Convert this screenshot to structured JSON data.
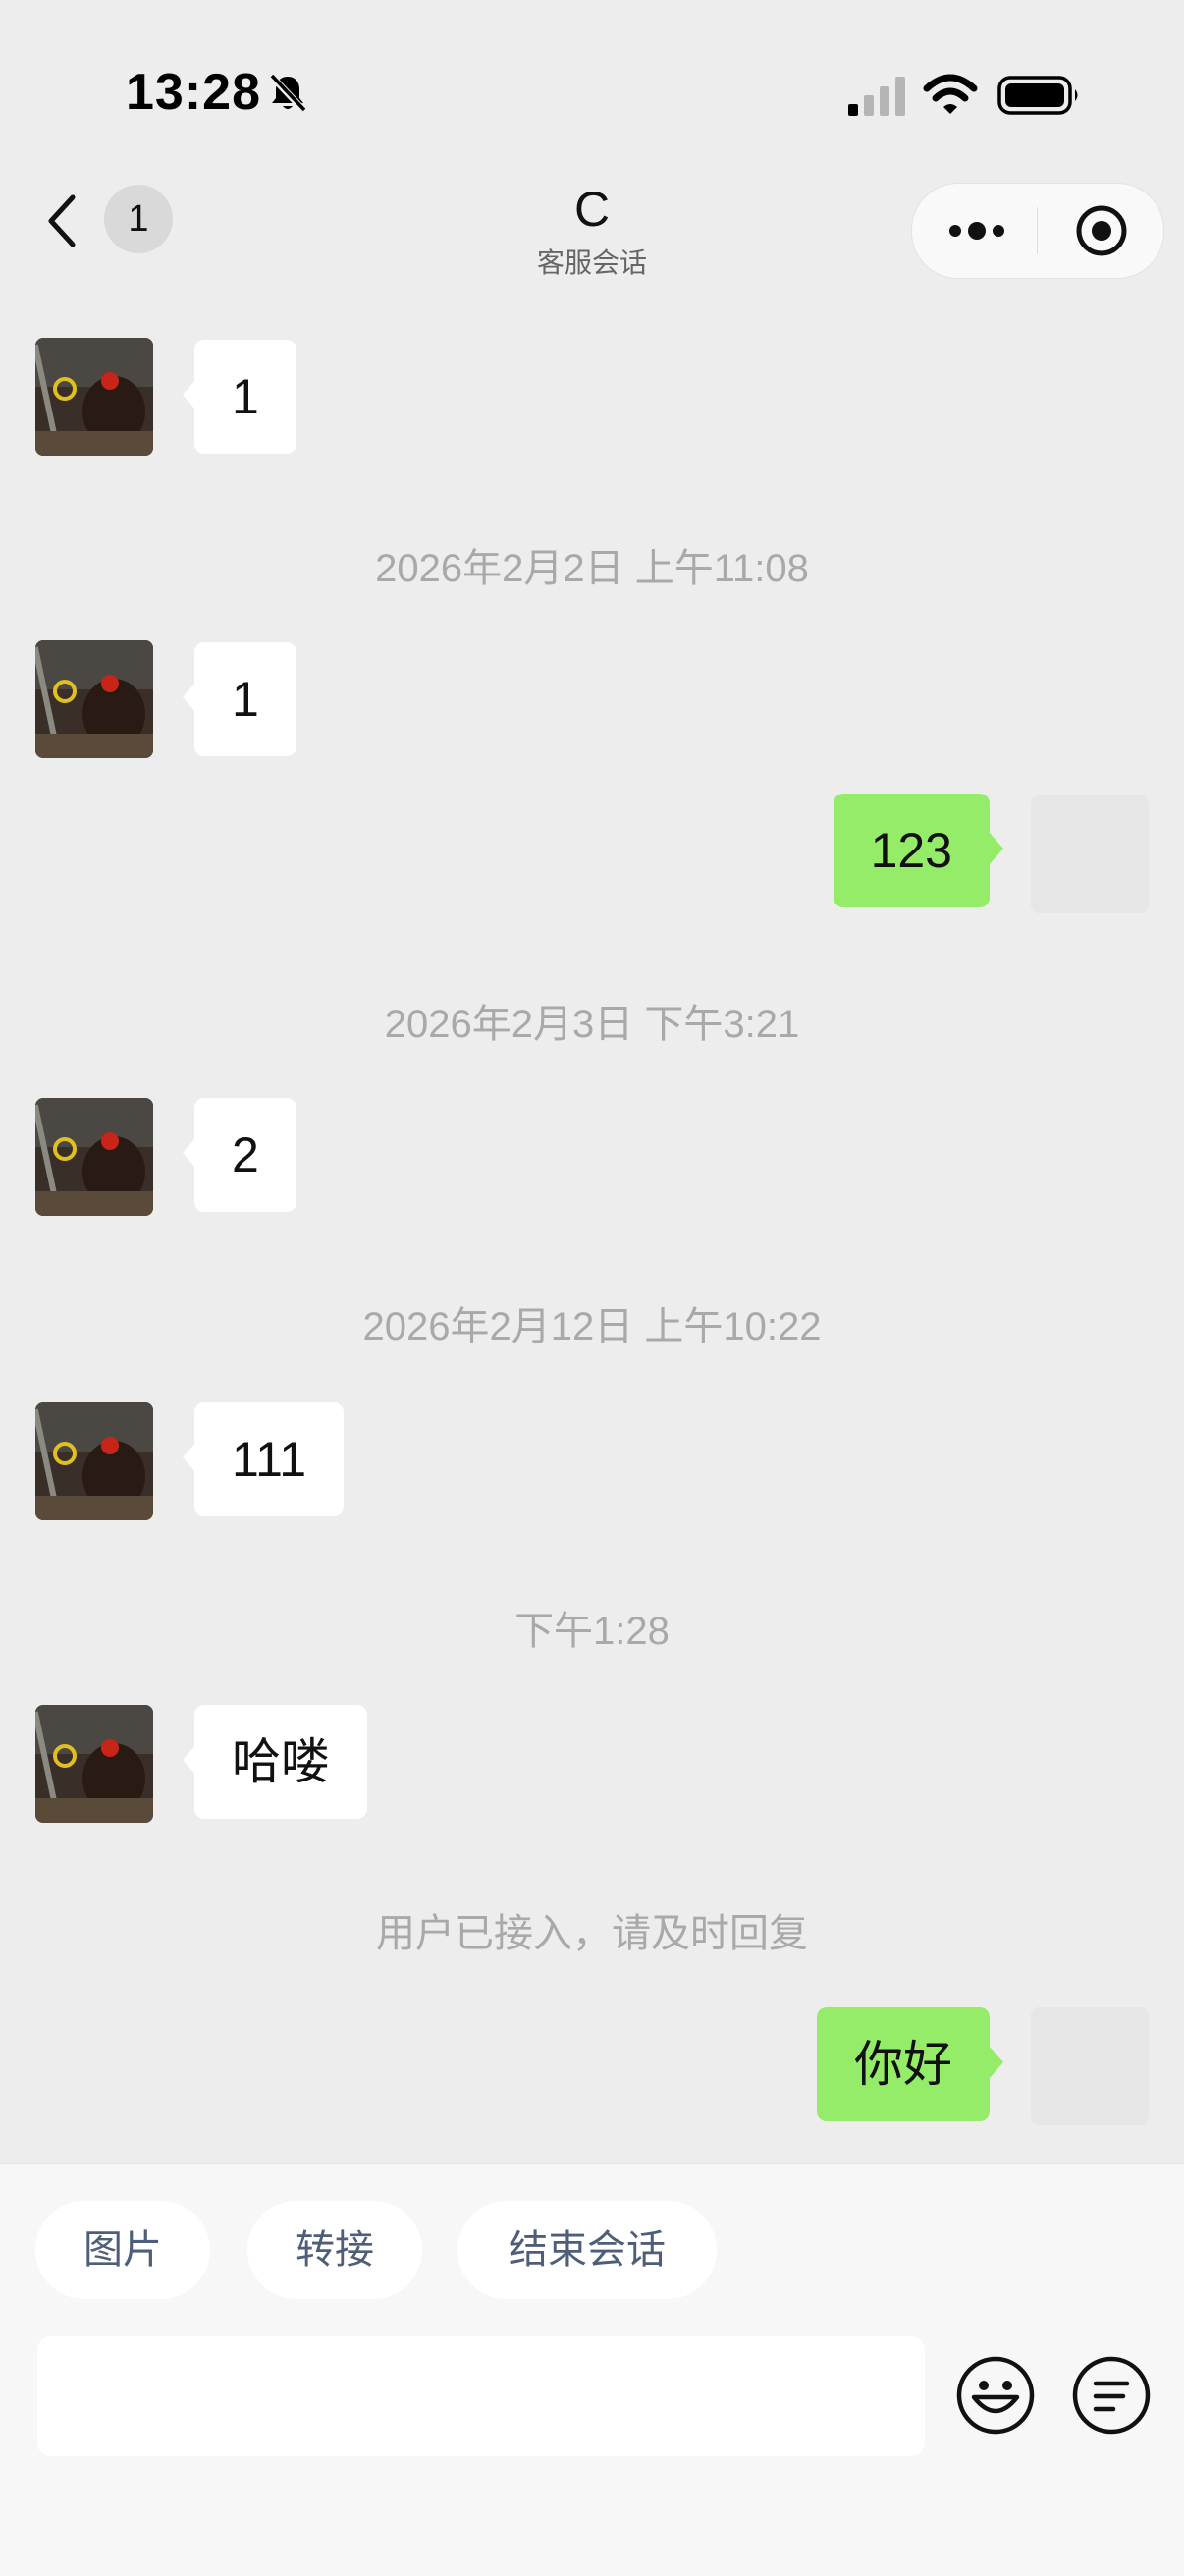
{
  "status_bar": {
    "time": "13:28"
  },
  "nav": {
    "unread_count": "1",
    "title": "C",
    "subtitle": "客服会话"
  },
  "messages": [
    {
      "text": "1"
    },
    {
      "timestamp": "2026年2月2日 上午11:08"
    },
    {
      "text": "1"
    },
    {
      "text": "123"
    },
    {
      "timestamp": "2026年2月3日 下午3:21"
    },
    {
      "text": "2"
    },
    {
      "timestamp": "2026年2月12日 上午10:22"
    },
    {
      "text": "111"
    },
    {
      "timestamp": "下午1:28"
    },
    {
      "text": "哈喽"
    },
    {
      "system": "用户已接入，请及时回复"
    },
    {
      "text": "你好"
    }
  ],
  "quick_actions": [
    "图片",
    "转接",
    "结束会话"
  ],
  "input": {
    "value": "",
    "placeholder": ""
  },
  "icons": [
    "back-icon",
    "mute-bell-icon",
    "signal-icon",
    "wifi-icon",
    "battery-icon",
    "more-icon",
    "target-icon",
    "emoji-icon",
    "menu-icon"
  ]
}
